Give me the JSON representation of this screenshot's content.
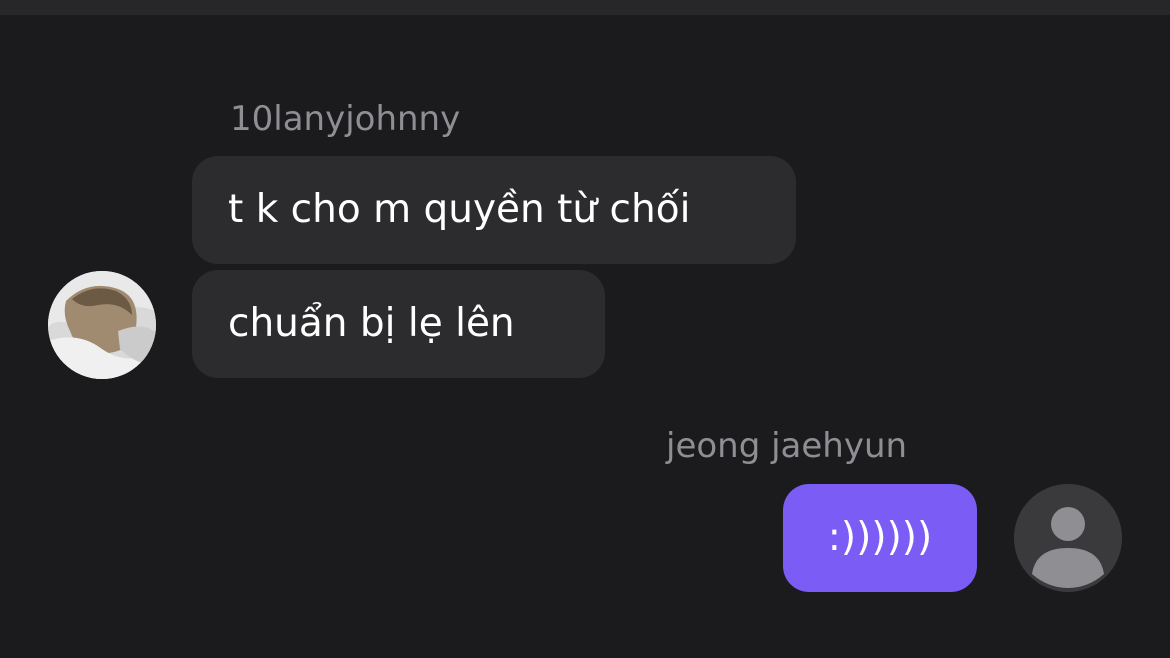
{
  "messages": [
    {
      "sender": "10lanyjohnny",
      "bubbles": [
        "t k cho m quyền từ chối",
        "chuẩn bị lẹ lên"
      ],
      "avatar": "user-photo"
    },
    {
      "sender": "jeong jaehyun",
      "bubbles": [
        ":))))))"
      ],
      "avatar": "default-user-icon"
    }
  ],
  "colors": {
    "background": "#1b1b1d",
    "incoming_bubble": "#2c2c2e",
    "outgoing_bubble": "#7b5cf5",
    "sender_name": "#8e8e93"
  }
}
